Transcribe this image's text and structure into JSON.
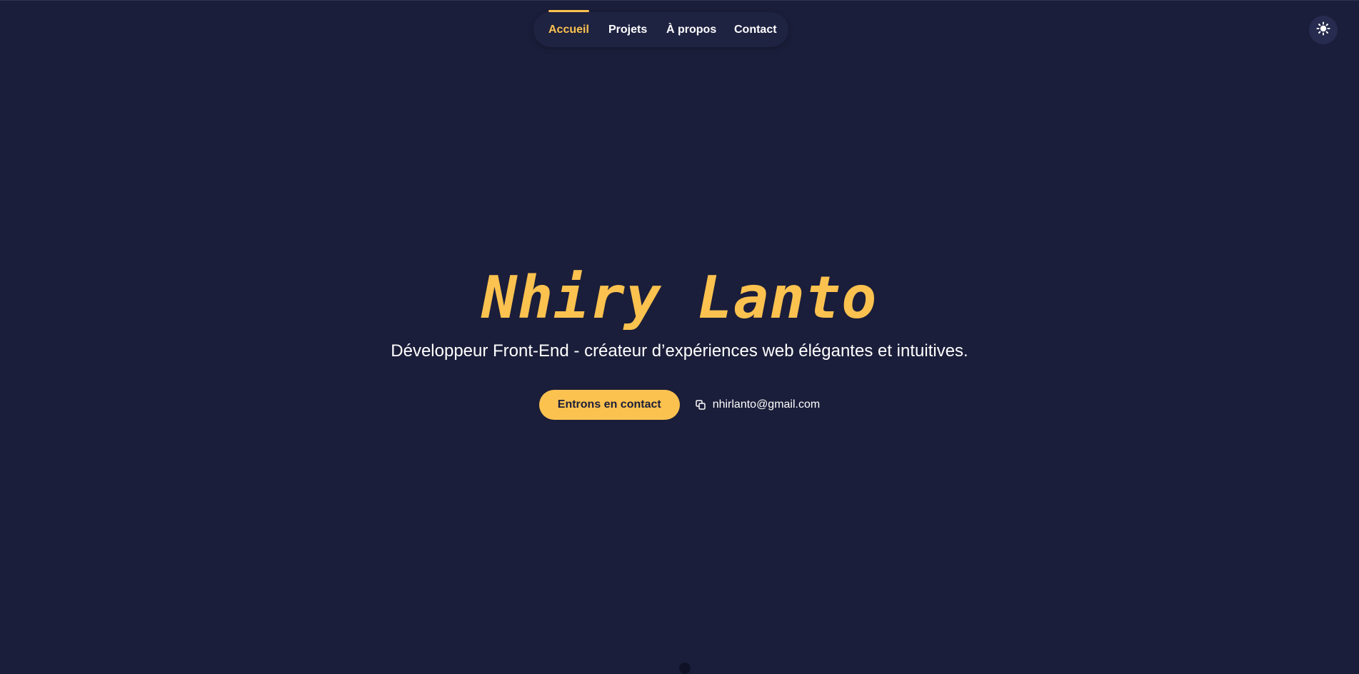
{
  "nav": {
    "items": [
      {
        "label": "Accueil",
        "active": true
      },
      {
        "label": "Projets",
        "active": false
      },
      {
        "label": "À propos",
        "active": false
      },
      {
        "label": "Contact",
        "active": false
      }
    ]
  },
  "theme_toggle": {
    "icon": "sun-icon"
  },
  "hero": {
    "title": "Nhiry Lanto",
    "subtitle": "Développeur Front-End - créateur d’expériences web élégantes et intuitives.",
    "cta_label": "Entrons en contact",
    "email": "nhirlanto@gmail.com",
    "email_icon": "copy-icon"
  },
  "colors": {
    "background": "#1b1e3a",
    "accent": "#fcc24f",
    "nav_background": "#1f2342",
    "text": "#ffffff"
  }
}
